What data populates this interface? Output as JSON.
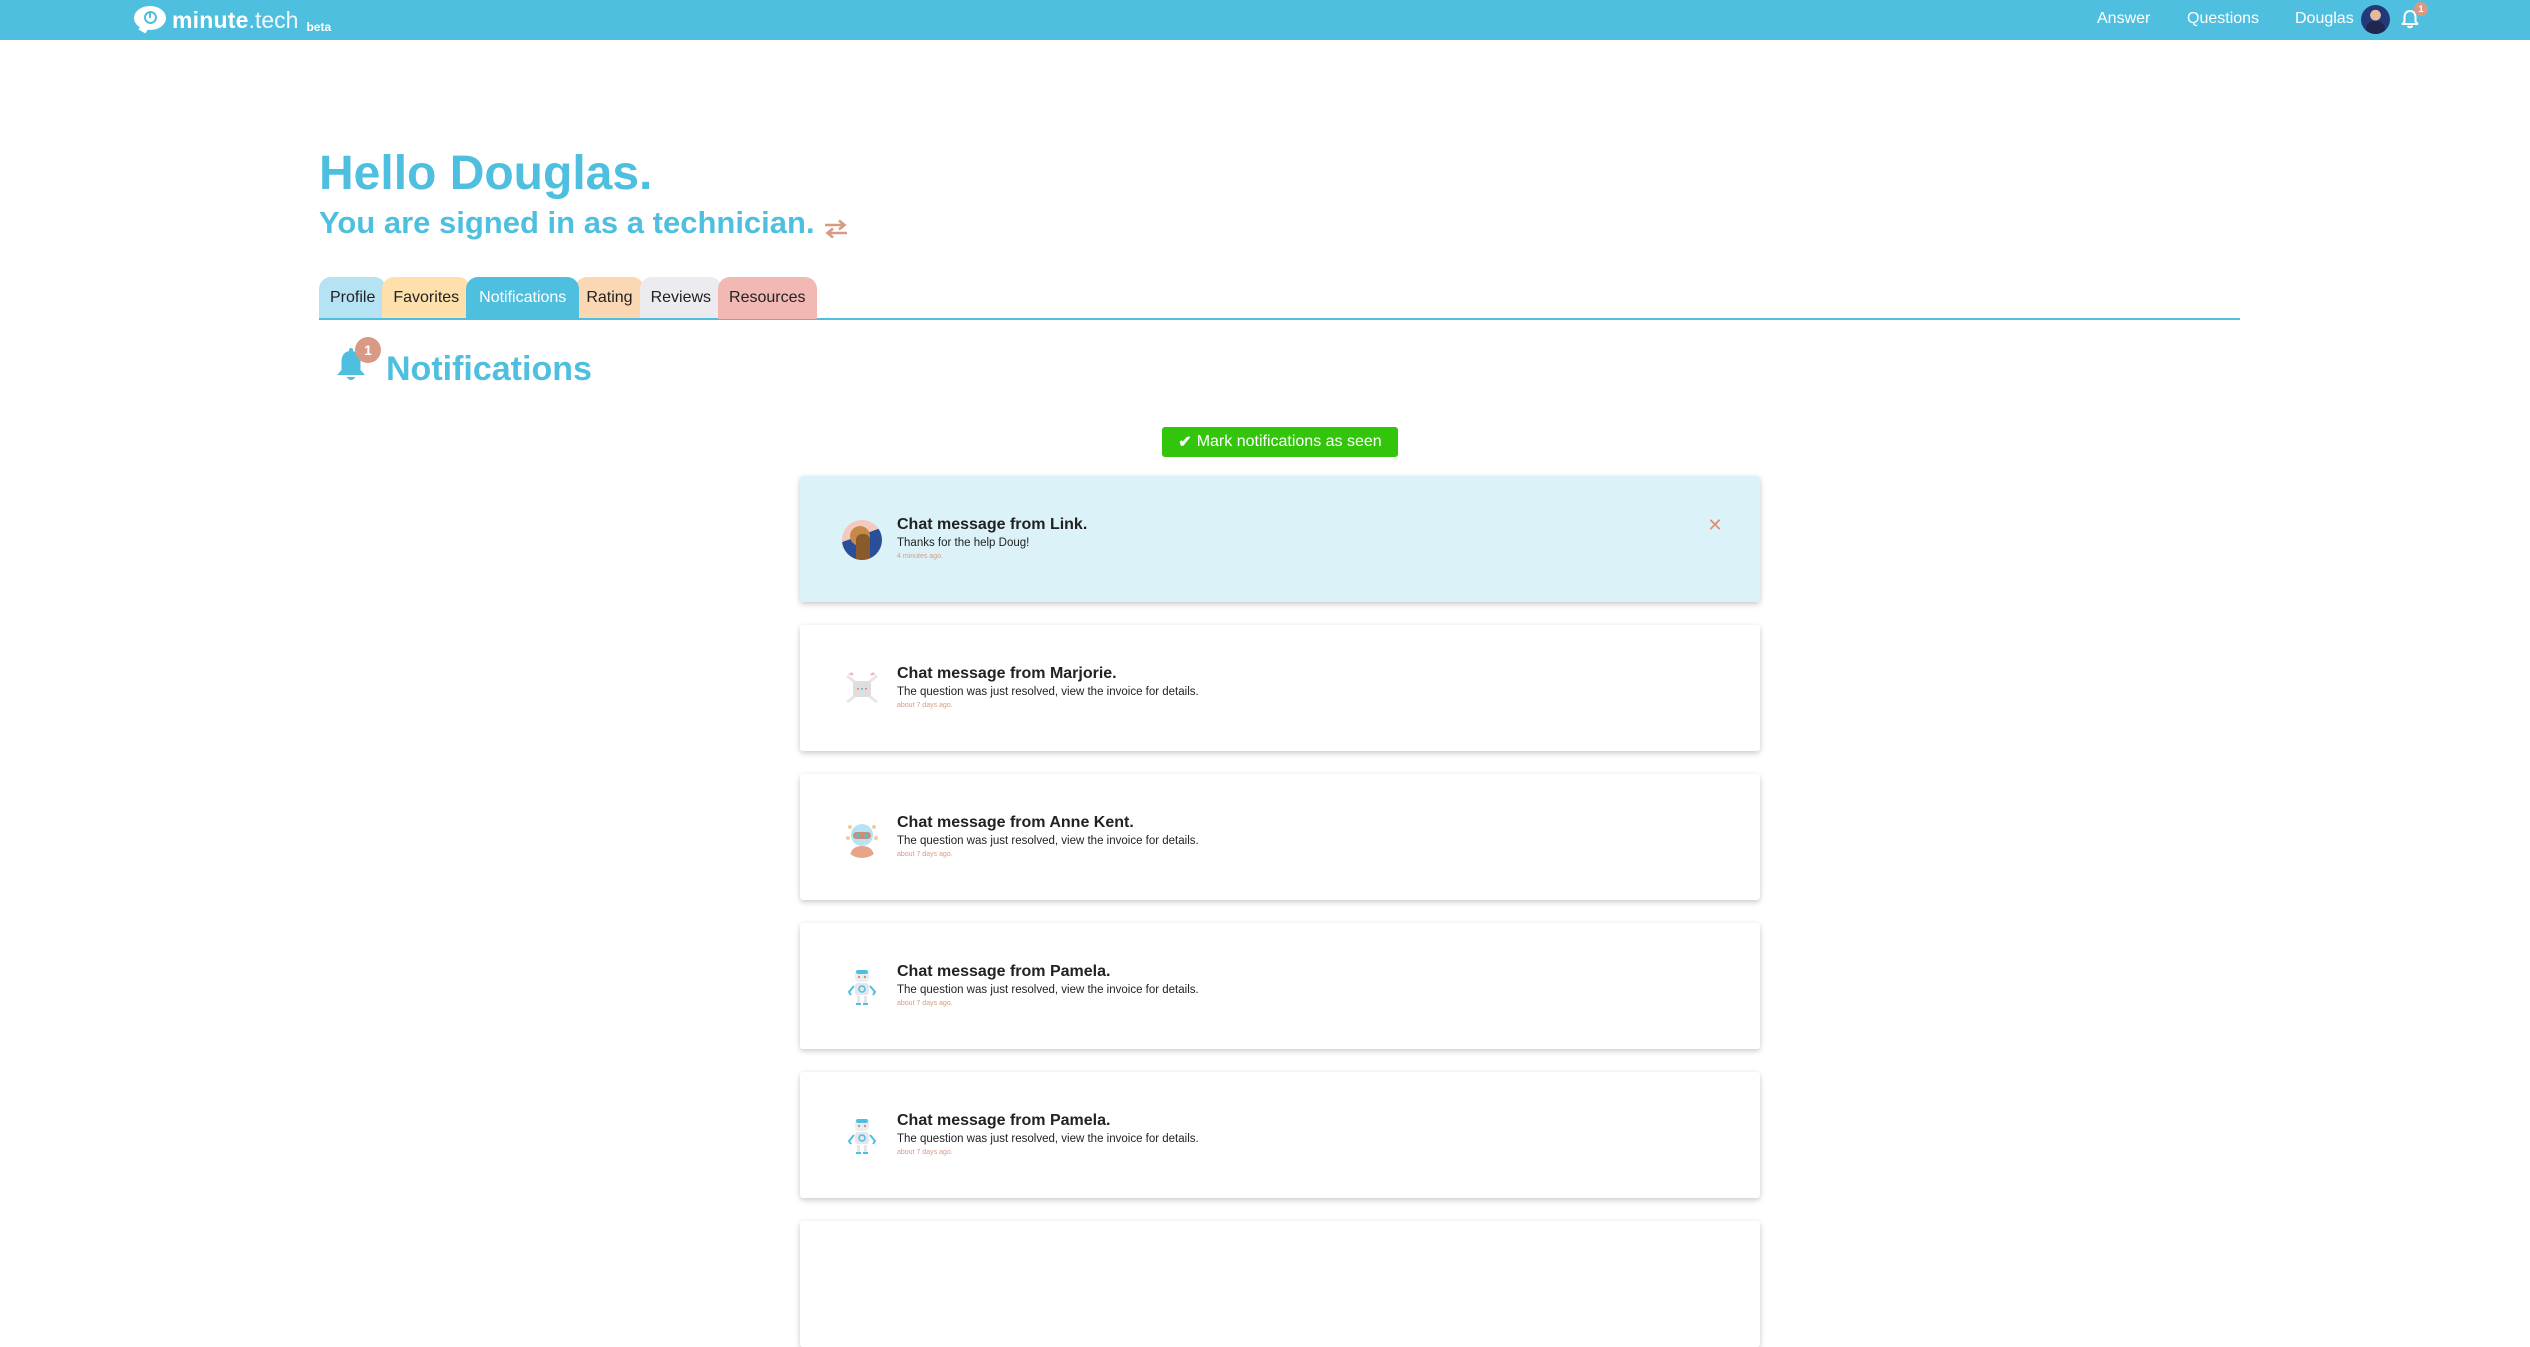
{
  "topbar": {
    "brand_bold": "minute",
    "brand_light": ".tech",
    "brand_beta": "beta",
    "links": [
      "Answer",
      "Questions",
      "Douglas"
    ],
    "bell_badge": "1",
    "bell_icon": "bell-icon",
    "avatar_icon": "user-avatar"
  },
  "greeting": {
    "hello": "Hello Douglas.",
    "signed_in": "You are signed in as a technician.",
    "switch_icon": "swap-arrows-icon"
  },
  "tabs": [
    {
      "label": "Profile"
    },
    {
      "label": "Favorites"
    },
    {
      "label": "Notifications",
      "active": true
    },
    {
      "label": "Rating"
    },
    {
      "label": "Reviews"
    },
    {
      "label": "Resources"
    }
  ],
  "colors": {
    "brand": "#4fbfe0",
    "accent_badge": "#d99a85",
    "button_green": "#33c50c",
    "unseen_card": "#dcf2f9"
  },
  "notifications_section": {
    "title": "Notifications",
    "badge": "1",
    "mark_seen_label": "Mark notifications as seen",
    "items": [
      {
        "title": "Chat message from Link.",
        "body": "Thanks for the help Doug!",
        "time": "4 minutes ago.",
        "unseen": true,
        "avatar": "link-avatar"
      },
      {
        "title": "Chat message from Marjorie.",
        "body": "The question was just resolved, view the invoice for details.",
        "time": "about 7 days ago.",
        "unseen": false,
        "avatar": "drone-avatar"
      },
      {
        "title": "Chat message from Anne Kent.",
        "body": "The question was just resolved, view the invoice for details.",
        "time": "about 7 days ago.",
        "unseen": false,
        "avatar": "robot-face-avatar"
      },
      {
        "title": "Chat message from Pamela.",
        "body": "The question was just resolved, view the invoice for details.",
        "time": "about 7 days ago.",
        "unseen": false,
        "avatar": "robot-avatar"
      },
      {
        "title": "Chat message from Pamela.",
        "body": "The question was just resolved, view the invoice for details.",
        "time": "about 7 days ago.",
        "unseen": false,
        "avatar": "robot-avatar"
      }
    ]
  }
}
